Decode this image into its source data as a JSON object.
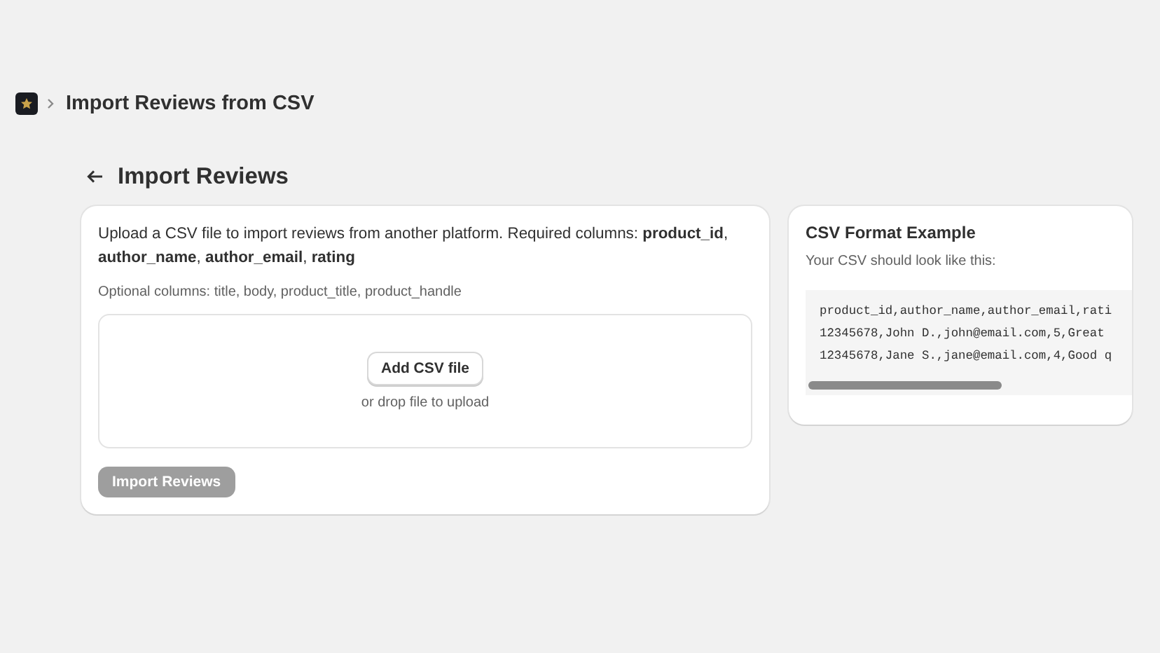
{
  "breadcrumb": {
    "title": "Import Reviews from CSV"
  },
  "page": {
    "title": "Import Reviews"
  },
  "upload_card": {
    "description": "Upload a CSV file to import reviews from another platform. Required columns: **product_id**, **author_name**, **author_email**, **rating**",
    "optional": "Optional columns: title, body, product_title, product_handle",
    "dropzone": {
      "button": "Add CSV file",
      "hint": "or drop file to upload"
    },
    "submit": {
      "label": "Import Reviews",
      "disabled": true
    }
  },
  "example_card": {
    "title": "CSV Format Example",
    "subtitle": "Your CSV should look like this:",
    "lines": [
      "product_id,author_name,author_email,rati",
      "12345678,John D.,john@email.com,5,Great",
      "12345678,Jane S.,jane@email.com,4,Good q"
    ]
  }
}
